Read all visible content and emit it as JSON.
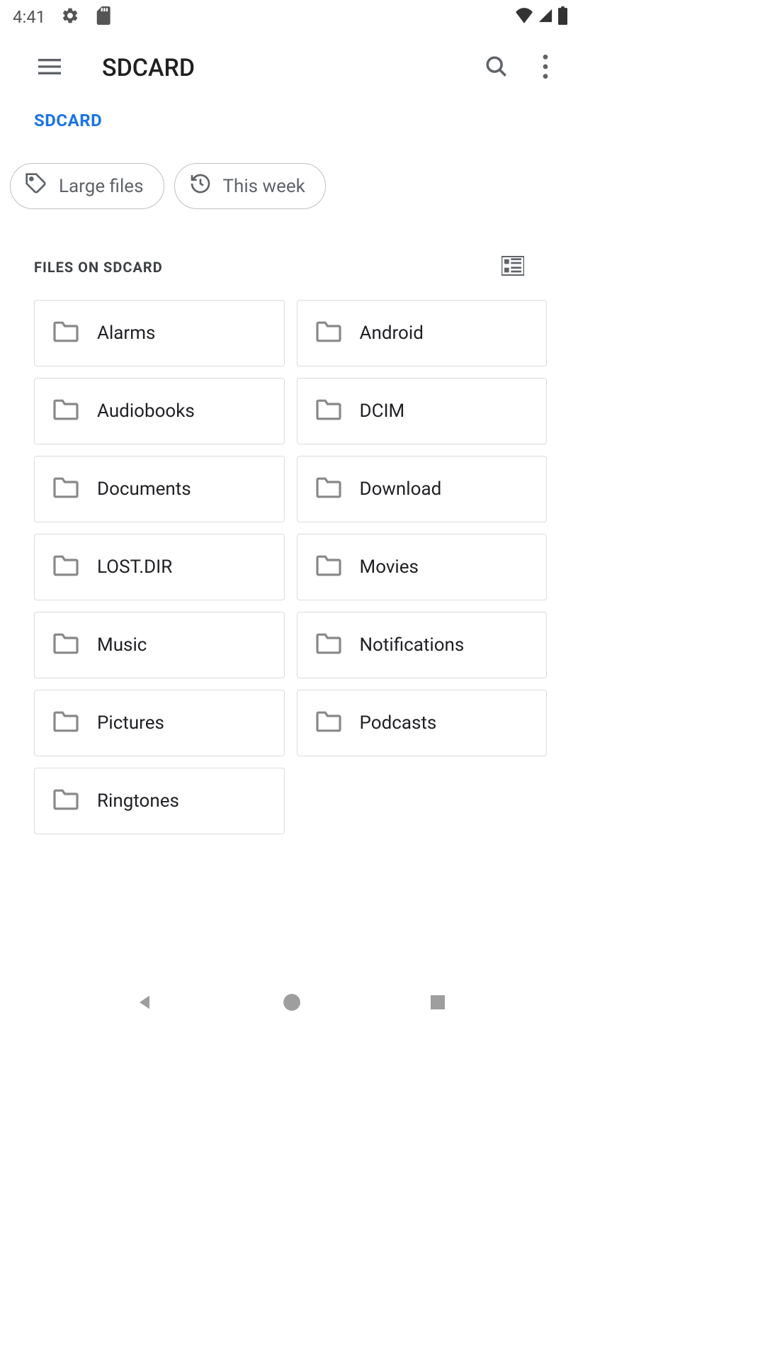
{
  "status": {
    "time": "4:41"
  },
  "appbar": {
    "title": "SDCARD"
  },
  "breadcrumb": {
    "current": "SDCARD"
  },
  "chips": [
    {
      "label": "Large files"
    },
    {
      "label": "This week"
    }
  ],
  "section": {
    "title": "FILES ON SDCARD"
  },
  "folders": [
    {
      "name": "Alarms"
    },
    {
      "name": "Android"
    },
    {
      "name": "Audiobooks"
    },
    {
      "name": "DCIM"
    },
    {
      "name": "Documents"
    },
    {
      "name": "Download"
    },
    {
      "name": "LOST.DIR"
    },
    {
      "name": "Movies"
    },
    {
      "name": "Music"
    },
    {
      "name": "Notifications"
    },
    {
      "name": "Pictures"
    },
    {
      "name": "Podcasts"
    },
    {
      "name": "Ringtones"
    }
  ]
}
